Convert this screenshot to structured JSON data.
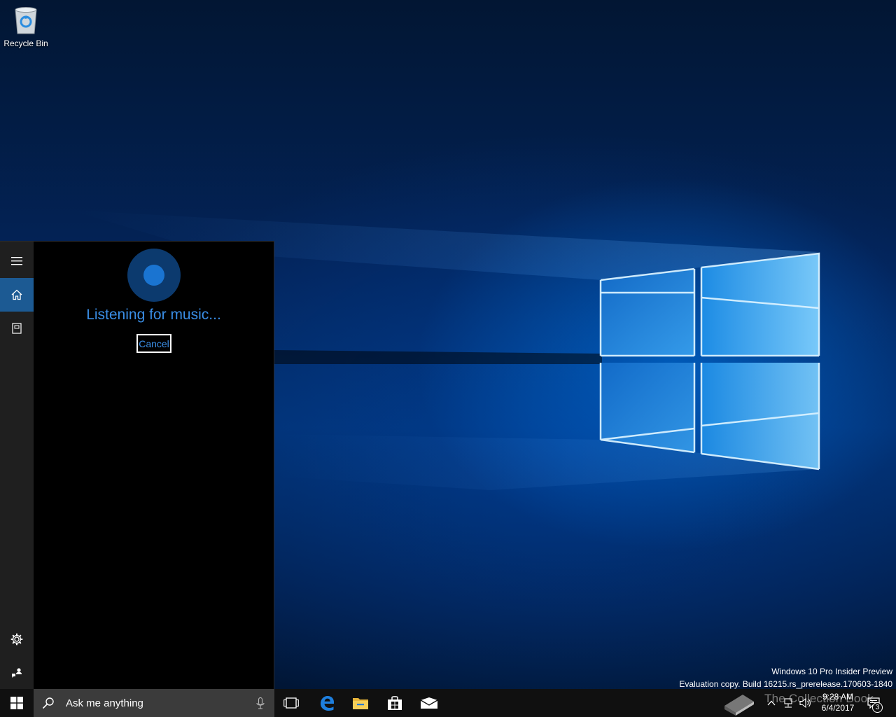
{
  "desktop": {
    "icons": [
      {
        "label": "Recycle Bin",
        "icon": "recycle-bin-icon"
      }
    ],
    "watermark": {
      "line1": "Windows 10 Pro Insider Preview",
      "line2": "Evaluation copy. Build 16215.rs_prerelease.170603-1840"
    }
  },
  "cortana": {
    "rail": {
      "menu_icon": "hamburger-menu-icon",
      "home_icon": "home-icon",
      "notebook_icon": "notebook-icon",
      "settings_icon": "gear-icon",
      "feedback_icon": "feedback-icon"
    },
    "status": "Listening for music...",
    "cancel_label": "Cancel"
  },
  "taskbar": {
    "start_icon": "windows-logo-icon",
    "search_placeholder": "Ask me anything",
    "pinned": [
      "task-view-icon",
      "edge-icon",
      "file-explorer-icon",
      "store-icon",
      "mail-icon"
    ],
    "tray": {
      "time": "9:28 AM",
      "date": "6/4/2017",
      "notification_count": "3",
      "overlay_text": "The Collection Book"
    }
  },
  "colors": {
    "accent": "#1a74d1",
    "cortana_text": "#3a8ee6",
    "taskbar": "#101010",
    "search_box": "#3b3b3b",
    "rail": "#1f1f1f",
    "rail_active": "#1c5a93"
  }
}
